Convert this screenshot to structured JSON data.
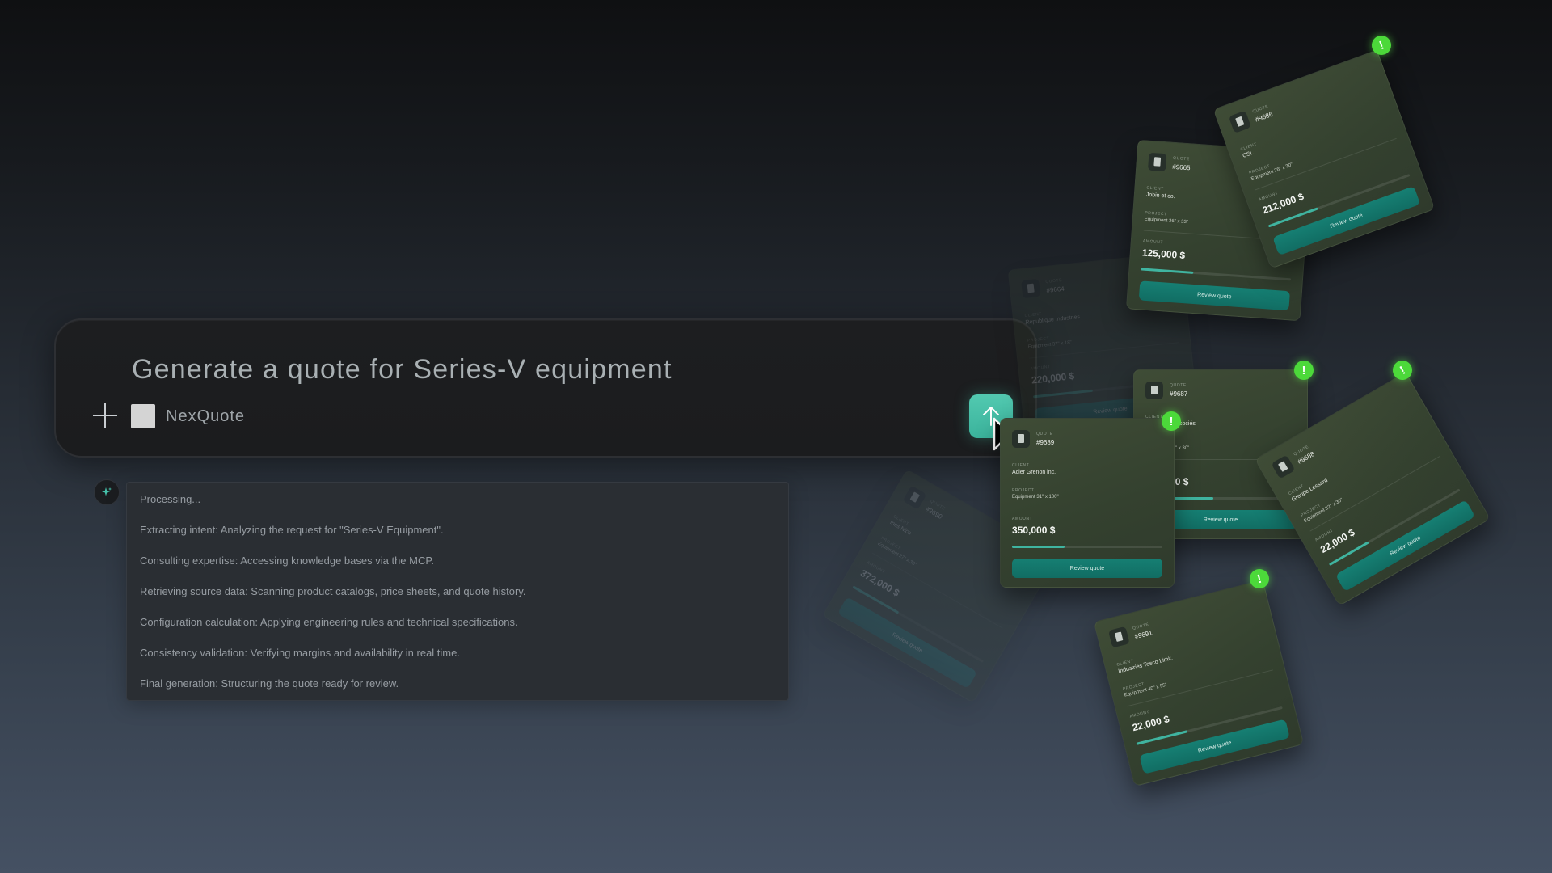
{
  "prompt": {
    "text": "Generate a quote for Series-V equipment",
    "tool_label": "NexQuote"
  },
  "log": {
    "lines": [
      "Processing...",
      "Extracting intent: Analyzing the request for \"Series-V Equipment\".",
      "Consulting expertise: Accessing knowledge bases via the MCP.",
      "Retrieving source data: Scanning product catalogs, price sheets, and quote history.",
      "Configuration calculation: Applying engineering rules and technical specifications.",
      "Consistency validation: Verifying margins and availability in real time.",
      "Final generation: Structuring the quote ready for review."
    ]
  },
  "card_labels": {
    "quote": "QUOTE",
    "client": "CLIENT",
    "project": "PROJECT",
    "amount": "AMOUNT",
    "button": "Review quote"
  },
  "alert_icon": "!",
  "colors": {
    "accent": "#3bb39c",
    "card_bg": "#3a4632",
    "button_bg": "#137568",
    "alert": "#4cd93a"
  },
  "quotes": [
    {
      "number": "#9664",
      "client": "Republique Industries",
      "project": "Equipment 37\" x 18\"",
      "amount": "220,000 $",
      "progress": 0.4,
      "faded": true,
      "alert": false
    },
    {
      "number": "#9690",
      "client": "Ines Nico",
      "project": "Equipment 27\" x 30\"",
      "amount": "372,000 $",
      "progress": 0.35,
      "faded": true,
      "alert": false
    },
    {
      "number": "#9665",
      "client": "Jobin et co.",
      "project": "Equipment 36\" x 33\"",
      "amount": "125,000 $",
      "progress": 0.35,
      "faded": false,
      "alert": false
    },
    {
      "number": "#9686",
      "client": "CSL",
      "project": "Equipment 26\" x 30\"",
      "amount": "212,000 $",
      "progress": 0.35,
      "faded": false,
      "alert": true
    },
    {
      "number": "#9687",
      "client": "Bernard et associés",
      "project": "Equipment 24\" x 30\"",
      "amount": "150,000 $",
      "progress": 0.45,
      "faded": false,
      "alert": true
    },
    {
      "number": "#9688",
      "client": "Groupe Lessard",
      "project": "Equipment 32\" x 30\"",
      "amount": "22,000 $",
      "progress": 0.3,
      "faded": false,
      "alert": true
    },
    {
      "number": "#9689",
      "client": "Acier Grenon inc.",
      "project": "Equipment 31\" x 100\"",
      "amount": "350,000 $",
      "progress": 0.35,
      "faded": false,
      "alert": true
    },
    {
      "number": "#9691",
      "client": "Industries Tesco Limit.",
      "project": "Equipment 40\" x 55\"",
      "amount": "22,000 $",
      "progress": 0.35,
      "faded": false,
      "alert": true
    }
  ]
}
